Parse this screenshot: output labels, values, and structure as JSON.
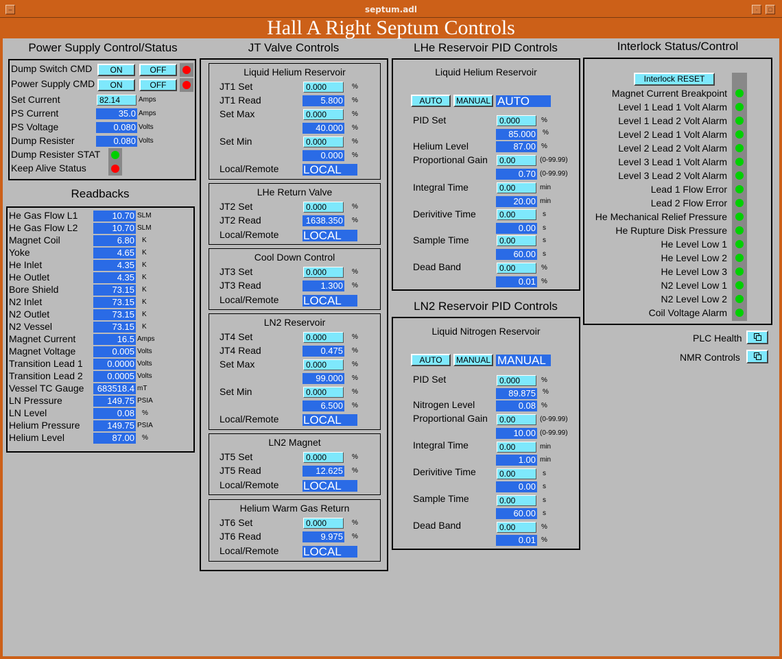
{
  "window": {
    "title": "septum.adl"
  },
  "header": {
    "title": "Hall A Right Septum Controls"
  },
  "power": {
    "title": "Power Supply Control/Status",
    "dump_switch_label": "Dump Switch CMD",
    "ps_cmd_label": "Power Supply CMD",
    "on_label": "ON",
    "off_label": "OFF",
    "rows": [
      {
        "label": "Set Current",
        "value": "82.14",
        "unit": "Amps"
      },
      {
        "label": "PS Current",
        "value": "35.0",
        "unit": "Amps"
      },
      {
        "label": "PS Voltage",
        "value": "0.080",
        "unit": "Volts"
      },
      {
        "label": "Dump Resister",
        "value": "0.080",
        "unit": "Volts"
      }
    ],
    "dump_stat_label": "Dump Resister STAT",
    "keep_alive_label": "Keep Alive Status",
    "colors": {
      "alarm": "#ff0000",
      "ok": "#00d000"
    }
  },
  "readbacks": {
    "title": "Readbacks",
    "rows": [
      {
        "label": "He Gas Flow L1",
        "value": "10.70",
        "unit": "SLM"
      },
      {
        "label": "He Gas Flow L2",
        "value": "10.70",
        "unit": "SLM"
      },
      {
        "label": "Magnet Coil",
        "value": "6.80",
        "unit": "K"
      },
      {
        "label": "Yoke",
        "value": "4.65",
        "unit": "K"
      },
      {
        "label": "He Inlet",
        "value": "4.35",
        "unit": "K"
      },
      {
        "label": "He Outlet",
        "value": "4.35",
        "unit": "K"
      },
      {
        "label": "Bore Shield",
        "value": "73.15",
        "unit": "K"
      },
      {
        "label": "N2 Inlet",
        "value": "73.15",
        "unit": "K"
      },
      {
        "label": "N2 Outlet",
        "value": "73.15",
        "unit": "K"
      },
      {
        "label": "N2 Vessel",
        "value": "73.15",
        "unit": "K"
      },
      {
        "label": "Magnet Current",
        "value": "16.5",
        "unit": "Amps"
      },
      {
        "label": "Magnet Voltage",
        "value": "0.005",
        "unit": "Volts"
      },
      {
        "label": "Transition Lead 1",
        "value": "0.0000",
        "unit": "Volts"
      },
      {
        "label": "Transition Lead 2",
        "value": "0.0005",
        "unit": "Volts"
      },
      {
        "label": "Vessel TC Gauge",
        "value": "683518.4",
        "unit": "mT"
      },
      {
        "label": "LN Pressure",
        "value": "149.75",
        "unit": "PSIA"
      },
      {
        "label": "LN Level",
        "value": "0.08",
        "unit": "%"
      },
      {
        "label": "Helium Pressure",
        "value": "149.75",
        "unit": "PSIA"
      },
      {
        "label": "Helium Level",
        "value": "87.00",
        "unit": "%"
      }
    ]
  },
  "jt": {
    "title": "JT Valve Controls",
    "local_remote_label": "Local/Remote",
    "set_max_label": "Set Max",
    "set_min_label": "Set Min",
    "pct": "%",
    "lhe_reservoir": {
      "title": "Liquid Helium Reservoir",
      "set_label": "JT1 Set",
      "set_value": "0.000",
      "read_label": "JT1 Read",
      "read_value": "5.800",
      "max_set": "0.000",
      "max_read": "40.000",
      "min_set": "0.000",
      "min_read": "0.000",
      "mode": "LOCAL"
    },
    "lhe_return": {
      "title": "LHe Return Valve",
      "set_label": "JT2 Set",
      "set_value": "0.000",
      "read_label": "JT2 Read",
      "read_value": "1638.350",
      "mode": "LOCAL"
    },
    "cool_down": {
      "title": "Cool Down Control",
      "set_label": "JT3 Set",
      "set_value": "0.000",
      "read_label": "JT3 Read",
      "read_value": "1.300",
      "mode": "LOCAL"
    },
    "ln2_reservoir": {
      "title": "LN2 Reservoir",
      "set_label": "JT4 Set",
      "set_value": "0.000",
      "read_label": "JT4 Read",
      "read_value": "0.475",
      "max_set": "0.000",
      "max_read": "99.000",
      "min_set": "0.000",
      "min_read": "6.500",
      "mode": "LOCAL"
    },
    "ln2_magnet": {
      "title": "LN2 Magnet",
      "set_label": "JT5 Set",
      "set_value": "0.000",
      "read_label": "JT5 Read",
      "read_value": "12.625",
      "mode": "LOCAL"
    },
    "warm_gas": {
      "title": "Helium Warm Gas Return",
      "set_label": "JT6 Set",
      "set_value": "0.000",
      "read_label": "JT6 Read",
      "read_value": "9.975",
      "mode": "LOCAL"
    }
  },
  "lhe_pid": {
    "title": "LHe Reservoir PID Controls",
    "subtitle": "Liquid Helium Reservoir",
    "auto_label": "AUTO",
    "manual_label": "MANUAL",
    "mode": "AUTO",
    "pid_set_label": "PID Set",
    "pid_set_input": "0.000",
    "pid_set_read": "85.000",
    "pid_unit": "%",
    "level_label": "Helium Level",
    "level_value": "87.00",
    "level_unit": "%",
    "pgain_label": "Proportional Gain",
    "pgain_input": "0.00",
    "pgain_read": "0.70",
    "pgain_unit": "(0-99.99)",
    "itime_label": "Integral Time",
    "itime_input": "0.00",
    "itime_read": "20.00",
    "itime_unit": "min",
    "dtime_label": "Derivitive Time",
    "dtime_input": "0.00",
    "dtime_read": "0.00",
    "dtime_unit": "s",
    "stime_label": "Sample Time",
    "stime_input": "0.00",
    "stime_read": "60.00",
    "stime_unit": "s",
    "dband_label": "Dead Band",
    "dband_input": "0.00",
    "dband_read": "0.01",
    "dband_unit": "%"
  },
  "ln2_pid": {
    "title": "LN2 Reservoir PID Controls",
    "subtitle": "Liquid Nitrogen Reservoir",
    "auto_label": "AUTO",
    "manual_label": "MANUAL",
    "mode": "MANUAL",
    "pid_set_label": "PID Set",
    "pid_set_input": "0.000",
    "pid_set_read": "89.875",
    "pid_unit": "%",
    "level_label": "Nitrogen Level",
    "level_value": "0.08",
    "level_unit": "%",
    "pgain_label": "Proportional Gain",
    "pgain_input": "0.00",
    "pgain_read": "10.00",
    "pgain_unit": "(0-99.99)",
    "itime_label": "Integral Time",
    "itime_input": "0.00",
    "itime_read": "1.00",
    "itime_unit": "min",
    "dtime_label": "Derivitive Time",
    "dtime_input": "0.00",
    "dtime_read": "0.00",
    "dtime_unit": "s",
    "stime_label": "Sample Time",
    "stime_input": "0.00",
    "stime_read": "60.00",
    "stime_unit": "s",
    "dband_label": "Dead Band",
    "dband_input": "0.00",
    "dband_read": "0.01",
    "dband_unit": "%"
  },
  "interlock": {
    "title": "Interlock Status/Control",
    "reset_label": "Interlock RESET",
    "items": [
      "Magnet Current Breakpoint",
      "Level 1 Lead 1 Volt Alarm",
      "Level 1 Lead 2 Volt Alarm",
      "Level 2 Lead 1 Volt Alarm",
      "Level 2 Lead 2 Volt Alarm",
      "Level 3 Lead 1 Volt Alarm",
      "Level 3 Lead 2 Volt Alarm",
      "Lead 1 Flow Error",
      "Lead 2 Flow Error",
      "He Mechanical Relief Pressure",
      "He Rupture Disk Pressure",
      "He Level Low 1",
      "He Level Low 2",
      "He Level Low 3",
      "N2 Level Low 1",
      "N2 Level Low 2",
      "Coil Voltage Alarm"
    ]
  },
  "related": {
    "plc_label": "PLC Health",
    "nmr_label": "NMR Controls",
    "icon": "related-display-icon"
  }
}
